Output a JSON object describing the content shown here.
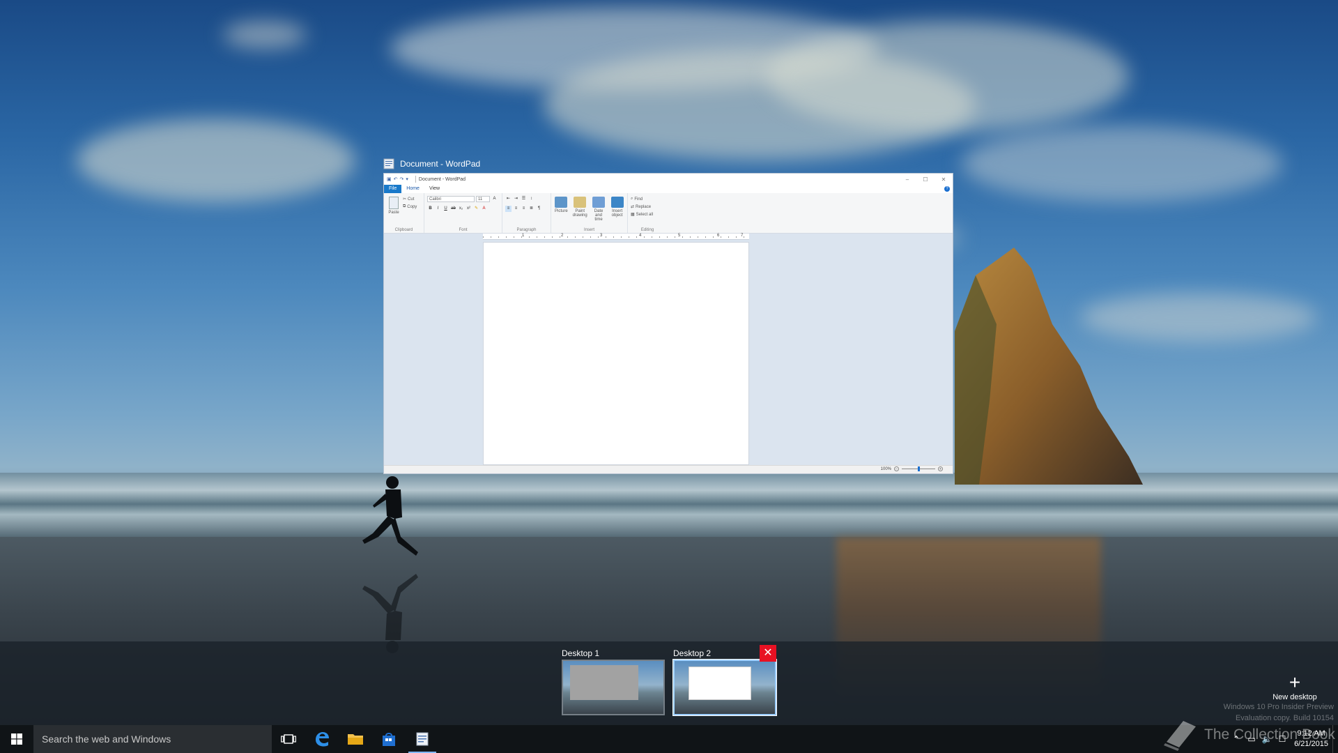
{
  "window": {
    "caption": "Document - WordPad",
    "inner_title": "Document - WordPad",
    "tabs": [
      "File",
      "Home",
      "View"
    ],
    "clipboard": {
      "paste": "Paste",
      "cut": "Cut",
      "copy": "Copy",
      "group": "Clipboard"
    },
    "font": {
      "name": "Calibri",
      "size": "11",
      "group": "Font"
    },
    "paragraph_group": "Paragraph",
    "insert": {
      "picture": "Picture",
      "paint": "Paint drawing",
      "datetime": "Date and time",
      "object": "Insert object",
      "group": "Insert"
    },
    "editing": {
      "find": "Find",
      "replace": "Replace",
      "select_all": "Select all",
      "group": "Editing"
    },
    "ruler_marks": [
      "1",
      "2",
      "3",
      "4",
      "5",
      "6",
      "7"
    ],
    "zoom": "100%"
  },
  "desktops": [
    {
      "label": "Desktop 1",
      "selected": false
    },
    {
      "label": "Desktop 2",
      "selected": true
    }
  ],
  "new_desktop": {
    "label": "New desktop",
    "plus": "+"
  },
  "close_glyph": "✕",
  "watermark": [
    "Windows 10 Pro Insider Preview",
    "Evaluation copy. Build 10154"
  ],
  "brand_watermark": "The Collection Book",
  "taskbar": {
    "search_placeholder": "Search the web and Windows",
    "time": "9:12 AM",
    "date": "6/21/2015"
  },
  "colors": {
    "accent": "#1979ca",
    "close": "#e81123",
    "taskbar": "#101417"
  }
}
